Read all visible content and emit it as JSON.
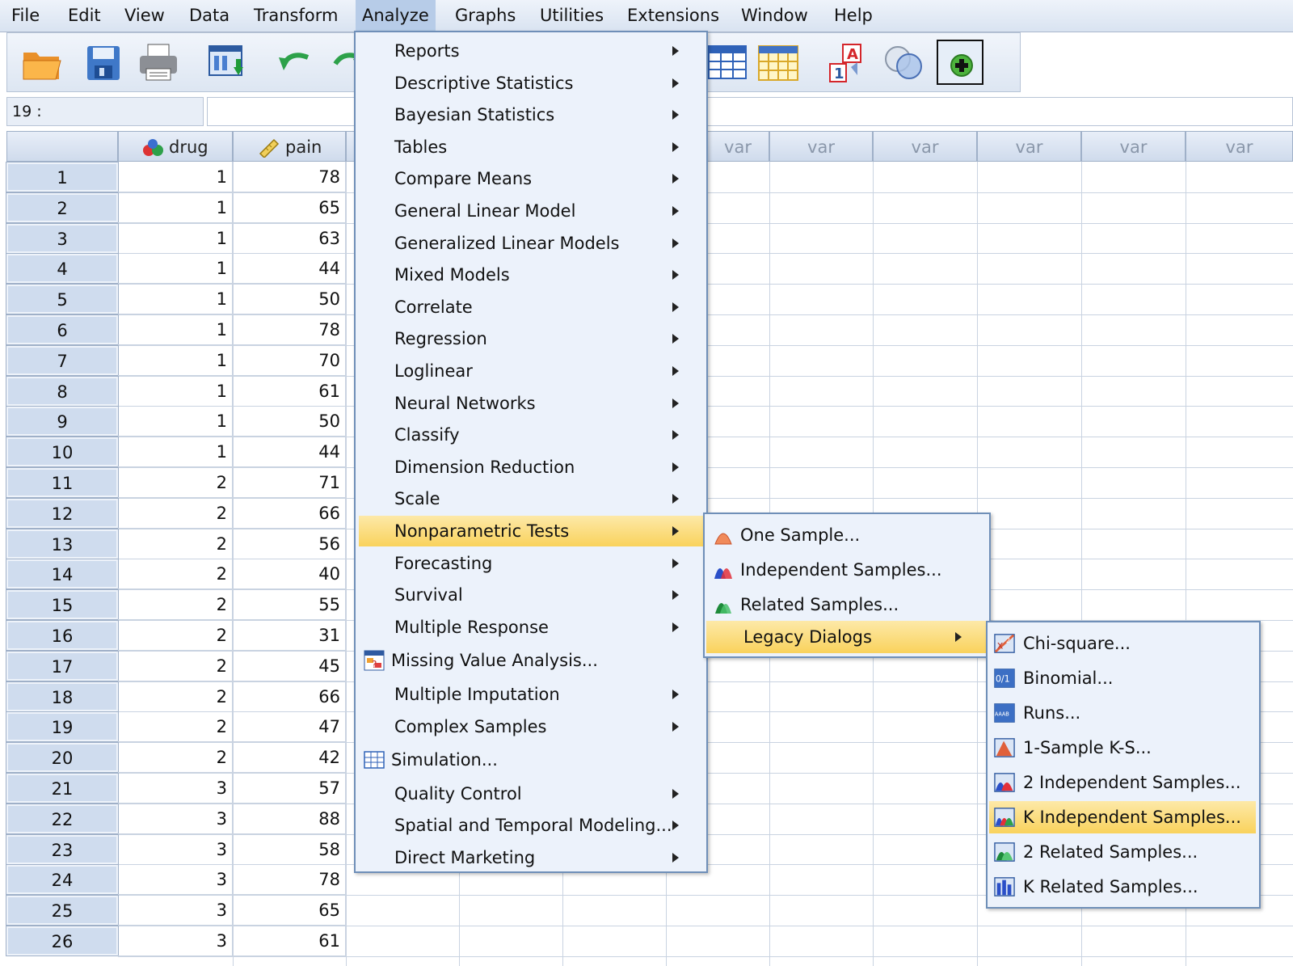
{
  "menubar": {
    "items": [
      "File",
      "Edit",
      "View",
      "Data",
      "Transform",
      "Analyze",
      "Graphs",
      "Utilities",
      "Extensions",
      "Window",
      "Help"
    ]
  },
  "toolbar": {
    "buttons": [
      "open-icon",
      "save-icon",
      "print-icon",
      "recall-dialog-icon",
      "undo-icon",
      "redo-icon",
      "split-table-icon",
      "grid-icon",
      "value-labels-icon",
      "sets-icon",
      "custom-add-icon"
    ]
  },
  "cell_editor": {
    "reference": "19 :",
    "value": ""
  },
  "grid": {
    "columns": [
      {
        "name": "drug",
        "icon": "nominal-icon"
      },
      {
        "name": "pain",
        "icon": "scale-icon"
      }
    ],
    "var_label": "var",
    "rows": [
      {
        "n": "1",
        "drug": "1",
        "pain": "78"
      },
      {
        "n": "2",
        "drug": "1",
        "pain": "65"
      },
      {
        "n": "3",
        "drug": "1",
        "pain": "63"
      },
      {
        "n": "4",
        "drug": "1",
        "pain": "44"
      },
      {
        "n": "5",
        "drug": "1",
        "pain": "50"
      },
      {
        "n": "6",
        "drug": "1",
        "pain": "78"
      },
      {
        "n": "7",
        "drug": "1",
        "pain": "70"
      },
      {
        "n": "8",
        "drug": "1",
        "pain": "61"
      },
      {
        "n": "9",
        "drug": "1",
        "pain": "50"
      },
      {
        "n": "10",
        "drug": "1",
        "pain": "44"
      },
      {
        "n": "11",
        "drug": "2",
        "pain": "71"
      },
      {
        "n": "12",
        "drug": "2",
        "pain": "66"
      },
      {
        "n": "13",
        "drug": "2",
        "pain": "56"
      },
      {
        "n": "14",
        "drug": "2",
        "pain": "40"
      },
      {
        "n": "15",
        "drug": "2",
        "pain": "55"
      },
      {
        "n": "16",
        "drug": "2",
        "pain": "31"
      },
      {
        "n": "17",
        "drug": "2",
        "pain": "45"
      },
      {
        "n": "18",
        "drug": "2",
        "pain": "66"
      },
      {
        "n": "19",
        "drug": "2",
        "pain": "47"
      },
      {
        "n": "20",
        "drug": "2",
        "pain": "42"
      },
      {
        "n": "21",
        "drug": "3",
        "pain": "57"
      },
      {
        "n": "22",
        "drug": "3",
        "pain": "88"
      },
      {
        "n": "23",
        "drug": "3",
        "pain": "58"
      },
      {
        "n": "24",
        "drug": "3",
        "pain": "78"
      },
      {
        "n": "25",
        "drug": "3",
        "pain": "65"
      },
      {
        "n": "26",
        "drug": "3",
        "pain": "61"
      }
    ]
  },
  "analyze_menu": {
    "items": [
      {
        "label": "Reports",
        "submenu": true
      },
      {
        "label": "Descriptive Statistics",
        "submenu": true
      },
      {
        "label": "Bayesian Statistics",
        "submenu": true
      },
      {
        "label": "Tables",
        "submenu": true
      },
      {
        "label": "Compare Means",
        "submenu": true
      },
      {
        "label": "General Linear Model",
        "submenu": true
      },
      {
        "label": "Generalized Linear Models",
        "submenu": true
      },
      {
        "label": "Mixed Models",
        "submenu": true
      },
      {
        "label": "Correlate",
        "submenu": true
      },
      {
        "label": "Regression",
        "submenu": true
      },
      {
        "label": "Loglinear",
        "submenu": true
      },
      {
        "label": "Neural Networks",
        "submenu": true
      },
      {
        "label": "Classify",
        "submenu": true
      },
      {
        "label": "Dimension Reduction",
        "submenu": true
      },
      {
        "label": "Scale",
        "submenu": true
      },
      {
        "label": "Nonparametric Tests",
        "submenu": true,
        "highlighted": true
      },
      {
        "label": "Forecasting",
        "submenu": true
      },
      {
        "label": "Survival",
        "submenu": true
      },
      {
        "label": "Multiple Response",
        "submenu": true
      },
      {
        "label": "Missing Value Analysis...",
        "submenu": false,
        "icon": "missing-value-icon"
      },
      {
        "label": "Multiple Imputation",
        "submenu": true
      },
      {
        "label": "Complex Samples",
        "submenu": true
      },
      {
        "label": "Simulation...",
        "submenu": false,
        "icon": "simulation-icon"
      },
      {
        "label": "Quality Control",
        "submenu": true
      },
      {
        "label": "Spatial and Temporal Modeling...",
        "submenu": true
      },
      {
        "label": "Direct Marketing",
        "submenu": true
      }
    ]
  },
  "nonparametric_menu": {
    "items": [
      {
        "label": "One Sample...",
        "icon": "one-sample-icon"
      },
      {
        "label": "Independent Samples...",
        "icon": "independent-samples-icon"
      },
      {
        "label": "Related Samples...",
        "icon": "related-samples-icon"
      },
      {
        "label": "Legacy Dialogs",
        "submenu": true,
        "highlighted": true
      }
    ]
  },
  "legacy_menu": {
    "items": [
      {
        "label": "Chi-square...",
        "icon": "chi-square-icon"
      },
      {
        "label": "Binomial...",
        "icon": "binomial-icon"
      },
      {
        "label": "Runs...",
        "icon": "runs-icon"
      },
      {
        "label": "1-Sample K-S...",
        "icon": "ks-icon"
      },
      {
        "label": "2 Independent Samples...",
        "icon": "two-independent-icon"
      },
      {
        "label": "K Independent Samples...",
        "icon": "k-independent-icon",
        "highlighted": true
      },
      {
        "label": "2 Related Samples...",
        "icon": "two-related-icon"
      },
      {
        "label": "K Related Samples...",
        "icon": "k-related-icon"
      }
    ]
  },
  "colors": {
    "menu_bg": "#ecf2fb",
    "highlight": "#f9d25c",
    "header_bg": "#cfdbec",
    "row_header_bg": "#cfdcee"
  }
}
